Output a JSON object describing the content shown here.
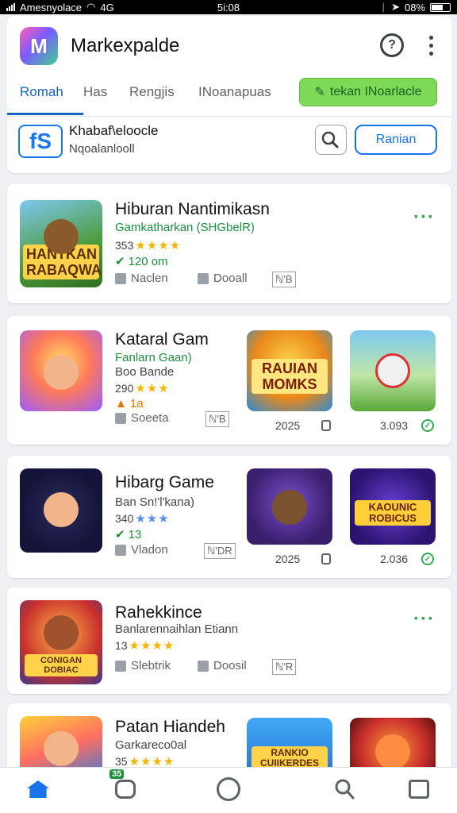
{
  "status_bar": {
    "carrier": "Amesnyolace",
    "network": "4G",
    "time": "5i:08",
    "battery": "08%"
  },
  "header": {
    "logo_text": "M",
    "title": "Markexpalde"
  },
  "tabs": [
    {
      "label": "Romah"
    },
    {
      "label": "Has"
    },
    {
      "label": "Rengjis"
    },
    {
      "label": "INoanapuas"
    }
  ],
  "tab_cta": {
    "label": "tekan INoarlacle"
  },
  "profile": {
    "name": "Khabaf\\eloocle",
    "subtitle": "Nqoalanlooll",
    "action_label": "Ranian"
  },
  "games": [
    {
      "thumb_banner": "HANTKAN RABAQWANA",
      "title": "Hiburan Nantimikasn",
      "subtitle": "Gamkatharkan (SHGbelR)",
      "rating": "353",
      "downloads": "120 om",
      "meta_left": "Naclen",
      "meta_mid": "Dooall",
      "meta_box": "ℕ'B"
    },
    {
      "thumb_banner": "",
      "title": "Kataral Gam",
      "subtitle": "Fanlarn Gaan)",
      "subtitle2": "Boo Bande",
      "rating": "290",
      "downloads": "1a",
      "meta_left": "Soeeta",
      "meta_box": "ℕ'B",
      "side1_banner": "RAUIAN MOMKS",
      "side1_value": "2025",
      "side2_value": "3.093"
    },
    {
      "title": "Hibarg Game",
      "subtitle": "Ban Sn!'l'kana)",
      "rating": "340",
      "downloads": "13",
      "meta_left": "Vladon",
      "meta_box": "ℕ'DR",
      "side1_banner": "",
      "side1_value": "2025",
      "side2_banner": "KAOUNIC ROBICUS",
      "side2_value": "2.036"
    },
    {
      "thumb_banner": "CONIGAN DOBIAC",
      "title": "Rahekkince",
      "subtitle": "Banlarennaihlan Etiann",
      "rating": "13",
      "meta_left": "Slebtrik",
      "meta_mid": "Doosil",
      "meta_box": "ℕ'R"
    },
    {
      "title": "Patan Hiandeh",
      "subtitle": "Garkareco0al",
      "rating": "35",
      "side1_banner": "RANKIO CUIIKERDES"
    }
  ],
  "bottom_nav": {
    "badge": "35"
  }
}
